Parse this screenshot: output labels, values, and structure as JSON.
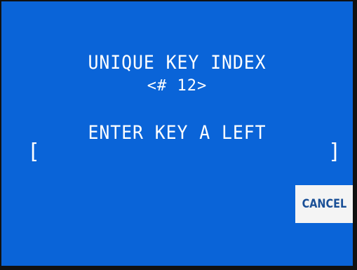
{
  "screen": {
    "title": "UNIQUE KEY INDEX",
    "index": "<# 12>",
    "prompt": "ENTER KEY A LEFT",
    "bracket_open": "[",
    "bracket_close": "]",
    "key_input_value": ""
  },
  "buttons": {
    "cancel_label": "CANCEL"
  },
  "colors": {
    "background": "#0a64d8",
    "text": "#ffffff",
    "button_bg": "#f4f4f4",
    "button_text": "#1a4f96"
  }
}
